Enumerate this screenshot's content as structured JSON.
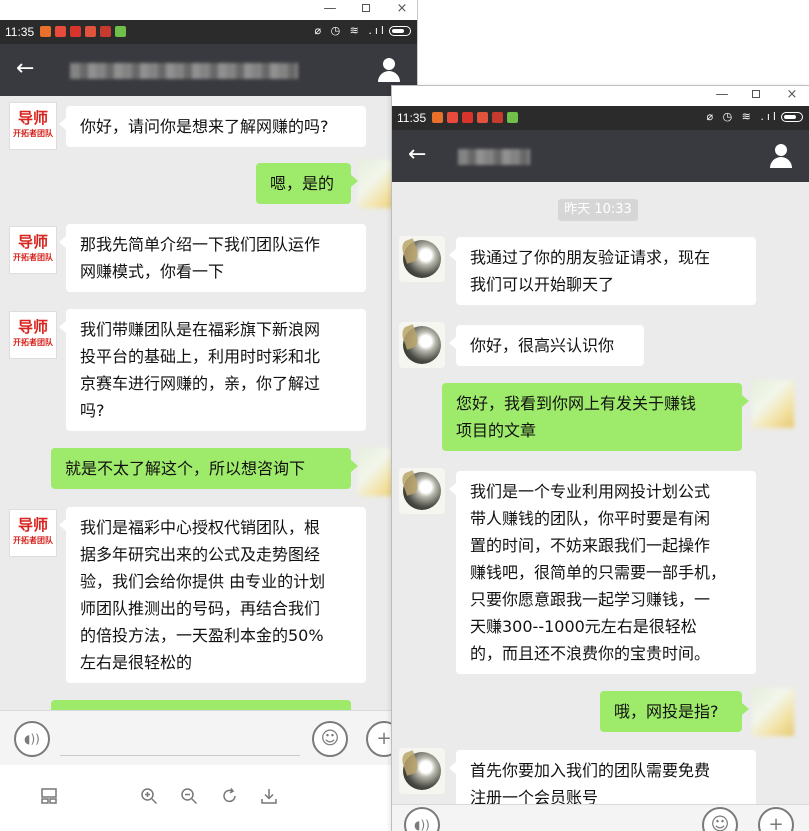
{
  "left_window": {
    "status": {
      "time": "11:35"
    },
    "messages": [
      {
        "from": "other",
        "text": "你好，请问你是想来了解网赚的吗?"
      },
      {
        "from": "me",
        "text": "嗯，是的"
      },
      {
        "from": "other",
        "text": "那我先简单介绍一下我们团队运作\n网赚模式，你看一下"
      },
      {
        "from": "other",
        "text": "我们带赚团队是在福彩旗下新浪网\n投平台的基础上，利用时时彩和北\n京赛车进行网赚的，亲，你了解过\n吗?"
      },
      {
        "from": "me",
        "text": "就是不太了解这个，所以想咨询下"
      },
      {
        "from": "other",
        "text": "我们是福彩中心授权代销团队，根\n据多年研究出来的公式及走势图经\n验，我们会给你提供 由专业的计划\n师团队推测出的号码，再结合我们\n的倍投方法，一天盈利本金的50%\n左右是很轻松的"
      }
    ],
    "avatar_text": {
      "main": "导师",
      "sub": "开拓者团队"
    }
  },
  "right_window": {
    "status": {
      "time": "11:35"
    },
    "timestamp": "昨天 10:33",
    "messages": [
      {
        "from": "other",
        "text": "我通过了你的朋友验证请求，现在\n我们可以开始聊天了"
      },
      {
        "from": "other",
        "text": "你好，很高兴认识你"
      },
      {
        "from": "me",
        "text": "您好，我看到你网上有发关于赚钱\n项目的文章"
      },
      {
        "from": "other",
        "text": "我们是一个专业利用网投计划公式\n带人赚钱的团队，你平时要是有闲\n置的时间，不妨来跟我们一起操作\n赚钱吧，很简单的只需要一部手机，\n只要你愿意跟我一起学习赚钱，一\n天赚300--1000元左右是很轻松\n的，而且还不浪费你的宝贵时间。"
      },
      {
        "from": "me",
        "text": "哦，网投是指?"
      },
      {
        "from": "other",
        "text": "首先你要加入我们的团队需要免费\n注册一个会员账号"
      }
    ]
  },
  "icons": {
    "window_minimize": "—",
    "window_maximize": "□",
    "window_close": "×",
    "back": "←",
    "voice": "◖))",
    "emoji": "☺",
    "add": "+"
  },
  "colors": {
    "titlebar": "#393a3f",
    "outgoing_bubble": "#9eea6a",
    "incoming_bubble": "#ffffff",
    "chat_background": "#ebebeb"
  }
}
